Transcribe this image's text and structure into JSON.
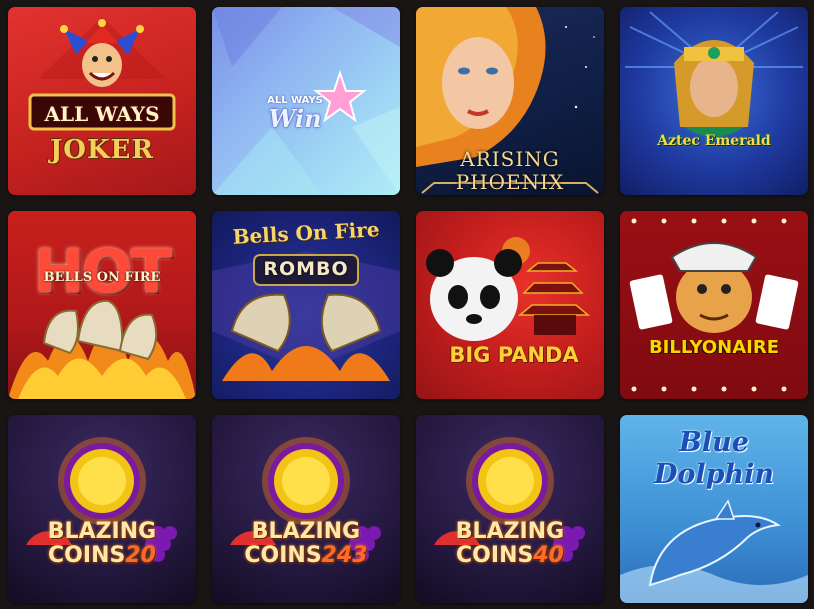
{
  "games": [
    {
      "line1": "ALL WAYS",
      "line2": "JOKER"
    },
    {
      "line1": "ALL WAYS",
      "line2": "Win"
    },
    {
      "line1": "ARISING",
      "line2": "PHOENIX"
    },
    {
      "line1": "Aztec Emerald"
    },
    {
      "line0": "HOT",
      "line1": "BELLS ON FIRE"
    },
    {
      "line1": "Bells On Fire",
      "line2": "ROMBO"
    },
    {
      "line1": "BIG PANDA"
    },
    {
      "line1": "BILLYONAIRE"
    },
    {
      "line1": "BLAZING",
      "line2": "COINS",
      "num": "20"
    },
    {
      "line1": "BLAZING",
      "line2": "COINS",
      "num": "243"
    },
    {
      "line1": "BLAZING",
      "line2": "COINS",
      "num": "40"
    },
    {
      "line1": "Blue",
      "line2": "Dolphin"
    }
  ]
}
